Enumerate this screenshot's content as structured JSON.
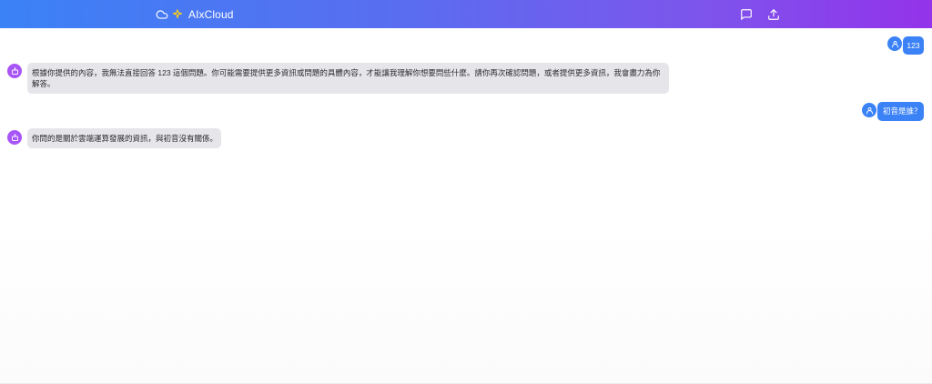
{
  "header": {
    "brand": "AIxCloud",
    "brand_icons": [
      "cloud-icon",
      "sparkle-icon"
    ],
    "actions": [
      "new-chat-icon",
      "share-icon"
    ]
  },
  "messages": [
    {
      "role": "user",
      "text": "123"
    },
    {
      "role": "assistant",
      "text": "根據你提供的內容，我無法直接回答 123 這個問題。你可能需要提供更多資訊或問題的具體內容，才能讓我理解你想要問些什麼。請你再次確認問題，或者提供更多資訊，我會盡力為你解答。"
    },
    {
      "role": "user",
      "text": "初音是誰？"
    },
    {
      "role": "assistant",
      "text": "你問的是關於雲端運算發展的資訊，與初音沒有關係。"
    }
  ],
  "colors": {
    "user_bubble": "#3b82f6",
    "assistant_bubble": "#e6e6ea",
    "user_avatar": "#3b82f6",
    "assistant_avatar": "#a855f7",
    "header_start": "#3b82f6",
    "header_end": "#9333ea"
  }
}
